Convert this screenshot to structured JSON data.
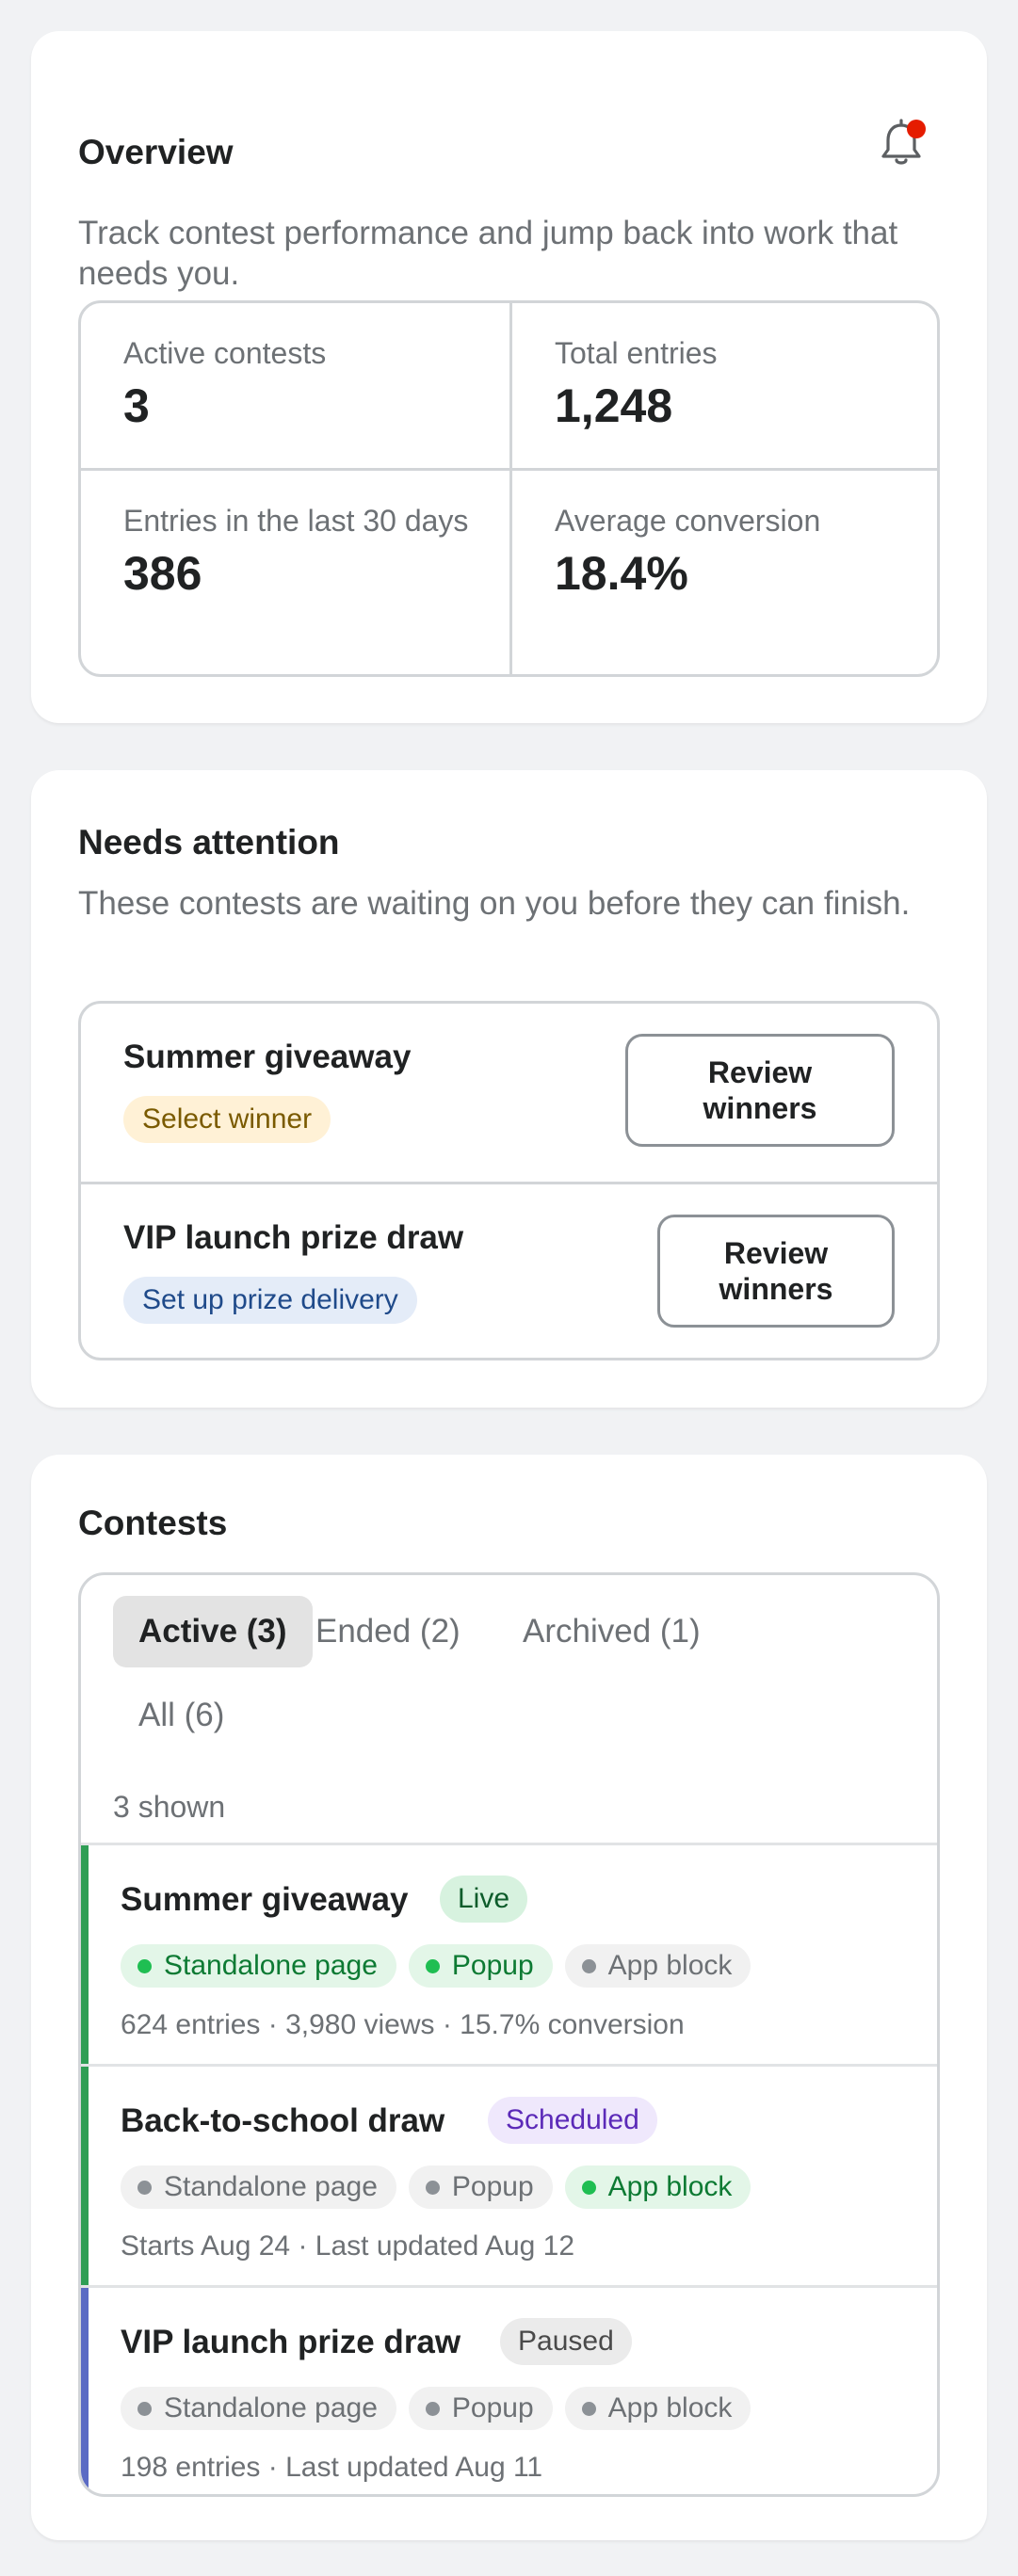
{
  "overview": {
    "title": "Overview",
    "subtitle": "Track contest performance and jump back into work that needs you.",
    "notification_icon": "bell-icon",
    "notification_dot_color": "#e51c00",
    "stats": [
      {
        "label": "Active contests",
        "value": "3"
      },
      {
        "label": "Total entries",
        "value": "1,248"
      },
      {
        "label": "Entries in the last 30 days",
        "value": "386"
      },
      {
        "label": "Average conversion",
        "value": "18.4%"
      }
    ]
  },
  "attention": {
    "title": "Needs attention",
    "subtitle": "These contests are waiting on you before they can finish.",
    "items": [
      {
        "name": "Summer giveaway",
        "badge": "Select winner",
        "button": "Review winners"
      },
      {
        "name": "VIP launch prize draw",
        "badge": "Set up prize delivery",
        "button": "Review winners"
      }
    ]
  },
  "contests": {
    "title": "Contests",
    "tabs": [
      {
        "label": "Active (3)",
        "selected": true
      },
      {
        "label": "Ended (2)",
        "selected": false
      },
      {
        "label": "Archived (1)",
        "selected": false
      },
      {
        "label": "All (6)",
        "selected": false
      }
    ],
    "shown_count": "3 shown",
    "rows": [
      {
        "name": "Summer giveaway",
        "status": "Live",
        "status_colors": {
          "bg": "#d7f2df",
          "fg": "#0d5c2b"
        },
        "accent_color": "#2f9e55",
        "placements": [
          {
            "label": "Standalone page",
            "enabled": true
          },
          {
            "label": "Popup",
            "enabled": true
          },
          {
            "label": "App block",
            "enabled": false
          }
        ],
        "meta": "624 entries · 3,980 views · 15.7% conversion"
      },
      {
        "name": "Back-to-school draw",
        "status": "Scheduled",
        "status_colors": {
          "bg": "#efe8fc",
          "fg": "#5b2ab8"
        },
        "accent_color": "#2f9e55",
        "placements": [
          {
            "label": "Standalone page",
            "enabled": false
          },
          {
            "label": "Popup",
            "enabled": false
          },
          {
            "label": "App block",
            "enabled": true
          }
        ],
        "meta": "Starts Aug 24 · Last updated Aug 12"
      },
      {
        "name": "VIP launch prize draw",
        "status": "Paused",
        "status_colors": {
          "bg": "#ebebeb",
          "fg": "#4a4a4a"
        },
        "accent_color": "#5b6bc4",
        "placements": [
          {
            "label": "Standalone page",
            "enabled": false
          },
          {
            "label": "Popup",
            "enabled": false
          },
          {
            "label": "App block",
            "enabled": false
          }
        ],
        "meta": "198 entries · Last updated Aug 11"
      }
    ]
  }
}
